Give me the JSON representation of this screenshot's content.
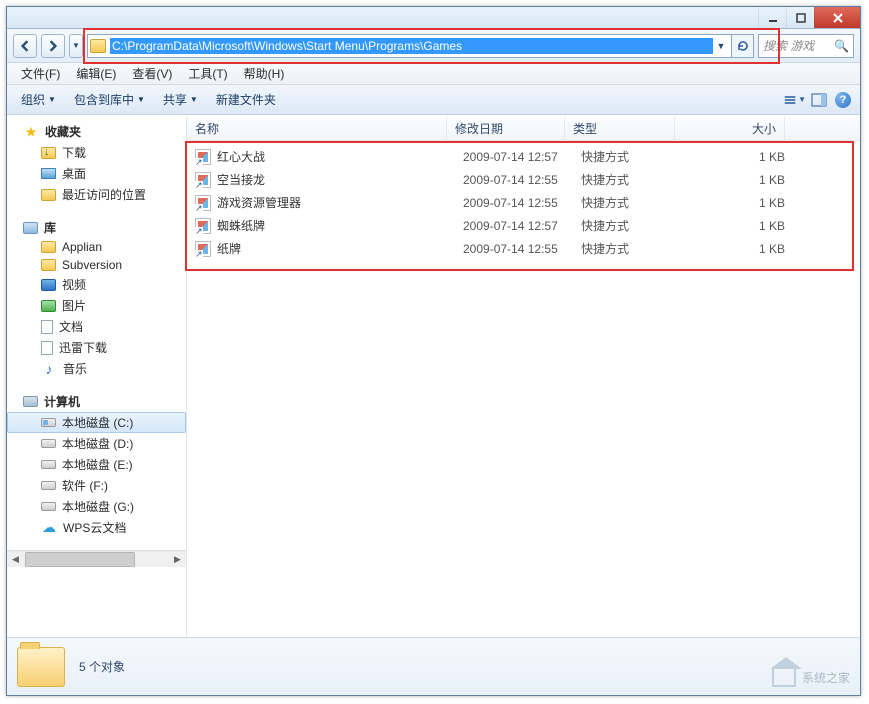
{
  "titlebar": {},
  "address": {
    "path": "C:\\ProgramData\\Microsoft\\Windows\\Start Menu\\Programs\\Games"
  },
  "search": {
    "placeholder": "搜索 游戏"
  },
  "menubar": [
    "文件(F)",
    "编辑(E)",
    "查看(V)",
    "工具(T)",
    "帮助(H)"
  ],
  "toolbar": {
    "organize": "组织",
    "include": "包含到库中",
    "share": "共享",
    "newfolder": "新建文件夹"
  },
  "sidebar": {
    "favorites": {
      "label": "收藏夹",
      "items": [
        "下载",
        "桌面",
        "最近访问的位置"
      ]
    },
    "libraries": {
      "label": "库",
      "items": [
        "Applian",
        "Subversion",
        "视频",
        "图片",
        "文档",
        "迅雷下载",
        "音乐"
      ]
    },
    "computer": {
      "label": "计算机",
      "items": [
        "本地磁盘 (C:)",
        "本地磁盘 (D:)",
        "本地磁盘 (E:)",
        "软件 (F:)",
        "本地磁盘 (G:)",
        "WPS云文档"
      ],
      "selected": 0
    }
  },
  "columns": {
    "name": "名称",
    "date": "修改日期",
    "type": "类型",
    "size": "大小"
  },
  "files": [
    {
      "name": "红心大战",
      "date": "2009-07-14 12:57",
      "type": "快捷方式",
      "size": "1 KB"
    },
    {
      "name": "空当接龙",
      "date": "2009-07-14 12:55",
      "type": "快捷方式",
      "size": "1 KB"
    },
    {
      "name": "游戏资源管理器",
      "date": "2009-07-14 12:55",
      "type": "快捷方式",
      "size": "1 KB"
    },
    {
      "name": "蜘蛛纸牌",
      "date": "2009-07-14 12:57",
      "type": "快捷方式",
      "size": "1 KB"
    },
    {
      "name": "纸牌",
      "date": "2009-07-14 12:55",
      "type": "快捷方式",
      "size": "1 KB"
    }
  ],
  "status": {
    "text": "5 个对象"
  },
  "watermark": "系统之家"
}
